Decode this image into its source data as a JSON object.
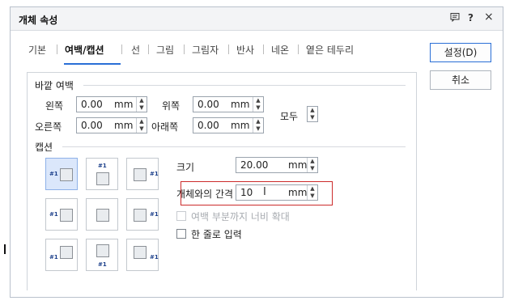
{
  "dialog": {
    "title": "개체 속성",
    "controls": {
      "help": "?",
      "close": "×"
    }
  },
  "tabs": [
    "기본",
    "여백/캡션",
    "선",
    "그림",
    "그림자",
    "반사",
    "네온",
    "옅은 테두리"
  ],
  "active_tab": "여백/캡션",
  "buttons": {
    "ok": "설정(D)",
    "cancel": "취소"
  },
  "outer_margin": {
    "heading": "바깥 여백",
    "left": {
      "label": "왼쪽",
      "value": "0.00",
      "unit": "mm"
    },
    "right": {
      "label": "오른쪽",
      "value": "0.00",
      "unit": "mm"
    },
    "top": {
      "label": "위쪽",
      "value": "0.00",
      "unit": "mm"
    },
    "bottom": {
      "label": "아래쪽",
      "value": "0.00",
      "unit": "mm"
    },
    "all": {
      "label": "모두"
    }
  },
  "caption": {
    "heading": "캡션",
    "tag": "#1",
    "size": {
      "label": "크기",
      "value": "20.00",
      "unit": "mm"
    },
    "gap": {
      "label": "개체와의 간격",
      "value": "10",
      "unit": "mm"
    },
    "expand_margin": {
      "label": "여백 부분까지 너비 확대",
      "checked": false,
      "enabled": false
    },
    "single_line": {
      "label": "한 줄로 입력",
      "checked": false,
      "enabled": true
    },
    "selected_position": "left-top"
  }
}
